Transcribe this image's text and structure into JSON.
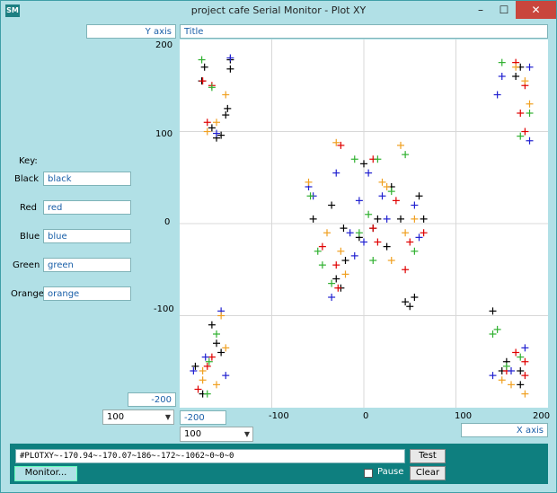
{
  "window": {
    "title": "project cafe Serial Monitor - Plot XY",
    "icon_text": "SM",
    "min_glyph": "–",
    "max_glyph": "☐",
    "close_glyph": "✕"
  },
  "plot": {
    "y_axis_label": "Y axis",
    "title": "Title",
    "x_axis_label": "X axis",
    "y_max": "200",
    "y_min": "-200",
    "x_min": "-200",
    "y_ticks": [
      "200",
      "100",
      "0",
      "-100"
    ],
    "x_ticks": [
      "-100",
      "0",
      "100",
      "200"
    ],
    "y_scale_select": "100",
    "x_scale_select": "100"
  },
  "key": {
    "heading": "Key:",
    "rows": [
      {
        "label": "Black",
        "value": "black",
        "color": "#000000"
      },
      {
        "label": "Red",
        "value": "red",
        "color": "#e00000"
      },
      {
        "label": "Blue",
        "value": "blue",
        "color": "#2020d0"
      },
      {
        "label": "Green",
        "value": "green",
        "color": "#30b030"
      },
      {
        "label": "Orange",
        "value": "orange",
        "color": "#f0a020"
      }
    ]
  },
  "controls": {
    "command": "#PLOTXY~-170.94~-170.07~186~-172~-1062~0~0~0",
    "test_label": "Test",
    "clear_label": "Clear",
    "pause_label": "Pause",
    "monitor_label": "Monitor...",
    "pause_checked": false
  },
  "colors": {
    "panel_bg": "#b1e0e6",
    "bottom_panel": "#0e7f7f",
    "grid": "#d8d8d8"
  },
  "chart_data": {
    "type": "scatter",
    "xlim": [
      -200,
      200
    ],
    "ylim": [
      -200,
      200
    ],
    "grid": true,
    "series": [
      {
        "name": "black",
        "color": "#000000",
        "points": [
          [
            -173,
            170
          ],
          [
            -176,
            155
          ],
          [
            -145,
            178
          ],
          [
            -145,
            168
          ],
          [
            -148,
            125
          ],
          [
            -150,
            118
          ],
          [
            -165,
            104
          ],
          [
            -155,
            96
          ],
          [
            -160,
            93
          ],
          [
            -35,
            20
          ],
          [
            -55,
            5
          ],
          [
            -22,
            -5
          ],
          [
            -20,
            -40
          ],
          [
            -30,
            -60
          ],
          [
            -25,
            -70
          ],
          [
            0,
            65
          ],
          [
            30,
            40
          ],
          [
            60,
            30
          ],
          [
            65,
            5
          ],
          [
            40,
            5
          ],
          [
            25,
            -25
          ],
          [
            50,
            -90
          ],
          [
            55,
            -80
          ],
          [
            45,
            -85
          ],
          [
            10,
            -5
          ],
          [
            15,
            5
          ],
          [
            -5,
            -15
          ],
          [
            140,
            -95
          ],
          [
            155,
            -150
          ],
          [
            150,
            -160
          ],
          [
            170,
            -160
          ],
          [
            170,
            -175
          ],
          [
            -183,
            -155
          ],
          [
            -160,
            -130
          ],
          [
            -155,
            -140
          ],
          [
            -165,
            -110
          ],
          [
            -175,
            -185
          ],
          [
            165,
            160
          ],
          [
            170,
            170
          ]
        ]
      },
      {
        "name": "red",
        "color": "#e00000",
        "points": [
          [
            -175,
            155
          ],
          [
            -170,
            110
          ],
          [
            -165,
            150
          ],
          [
            -25,
            85
          ],
          [
            -45,
            -25
          ],
          [
            -30,
            -45
          ],
          [
            -28,
            -70
          ],
          [
            10,
            70
          ],
          [
            50,
            -20
          ],
          [
            45,
            -50
          ],
          [
            65,
            -10
          ],
          [
            35,
            25
          ],
          [
            10,
            -5
          ],
          [
            15,
            -20
          ],
          [
            165,
            175
          ],
          [
            175,
            150
          ],
          [
            170,
            120
          ],
          [
            175,
            100
          ],
          [
            155,
            -160
          ],
          [
            165,
            -140
          ],
          [
            175,
            -150
          ],
          [
            -180,
            -180
          ],
          [
            -165,
            -145
          ],
          [
            -170,
            -155
          ],
          [
            175,
            -165
          ]
        ]
      },
      {
        "name": "blue",
        "color": "#2020d0",
        "points": [
          [
            -145,
            180
          ],
          [
            -160,
            98
          ],
          [
            -60,
            40
          ],
          [
            -55,
            30
          ],
          [
            -30,
            55
          ],
          [
            -15,
            -10
          ],
          [
            -10,
            -35
          ],
          [
            -35,
            -80
          ],
          [
            5,
            55
          ],
          [
            20,
            30
          ],
          [
            25,
            5
          ],
          [
            60,
            -15
          ],
          [
            55,
            20
          ],
          [
            0,
            -20
          ],
          [
            -5,
            25
          ],
          [
            150,
            160
          ],
          [
            145,
            140
          ],
          [
            180,
            170
          ],
          [
            180,
            90
          ],
          [
            160,
            -160
          ],
          [
            140,
            -165
          ],
          [
            175,
            -135
          ],
          [
            -185,
            -160
          ],
          [
            -172,
            -145
          ],
          [
            -155,
            -95
          ],
          [
            -150,
            -165
          ]
        ]
      },
      {
        "name": "green",
        "color": "#30b030",
        "points": [
          [
            -176,
            178
          ],
          [
            -165,
            148
          ],
          [
            -58,
            30
          ],
          [
            -50,
            -30
          ],
          [
            -45,
            -45
          ],
          [
            -35,
            -65
          ],
          [
            -10,
            70
          ],
          [
            15,
            70
          ],
          [
            30,
            35
          ],
          [
            45,
            75
          ],
          [
            5,
            10
          ],
          [
            -5,
            -10
          ],
          [
            10,
            -40
          ],
          [
            55,
            -30
          ],
          [
            150,
            175
          ],
          [
            180,
            120
          ],
          [
            170,
            95
          ],
          [
            140,
            -120
          ],
          [
            145,
            -115
          ],
          [
            155,
            -155
          ],
          [
            -168,
            -150
          ],
          [
            -160,
            -120
          ],
          [
            -170,
            -185
          ],
          [
            170,
            -145
          ]
        ]
      },
      {
        "name": "orange",
        "color": "#f0a020",
        "points": [
          [
            -150,
            140
          ],
          [
            -160,
            110
          ],
          [
            -170,
            100
          ],
          [
            -30,
            88
          ],
          [
            -60,
            45
          ],
          [
            -40,
            -10
          ],
          [
            -25,
            -30
          ],
          [
            -20,
            -55
          ],
          [
            20,
            45
          ],
          [
            25,
            40
          ],
          [
            45,
            -10
          ],
          [
            30,
            -40
          ],
          [
            55,
            5
          ],
          [
            40,
            85
          ],
          [
            175,
            155
          ],
          [
            180,
            130
          ],
          [
            165,
            170
          ],
          [
            150,
            -170
          ],
          [
            160,
            -175
          ],
          [
            -175,
            -160
          ],
          [
            -160,
            -175
          ],
          [
            -150,
            -135
          ],
          [
            -155,
            -100
          ],
          [
            -175,
            -170
          ],
          [
            175,
            -185
          ]
        ]
      }
    ]
  }
}
